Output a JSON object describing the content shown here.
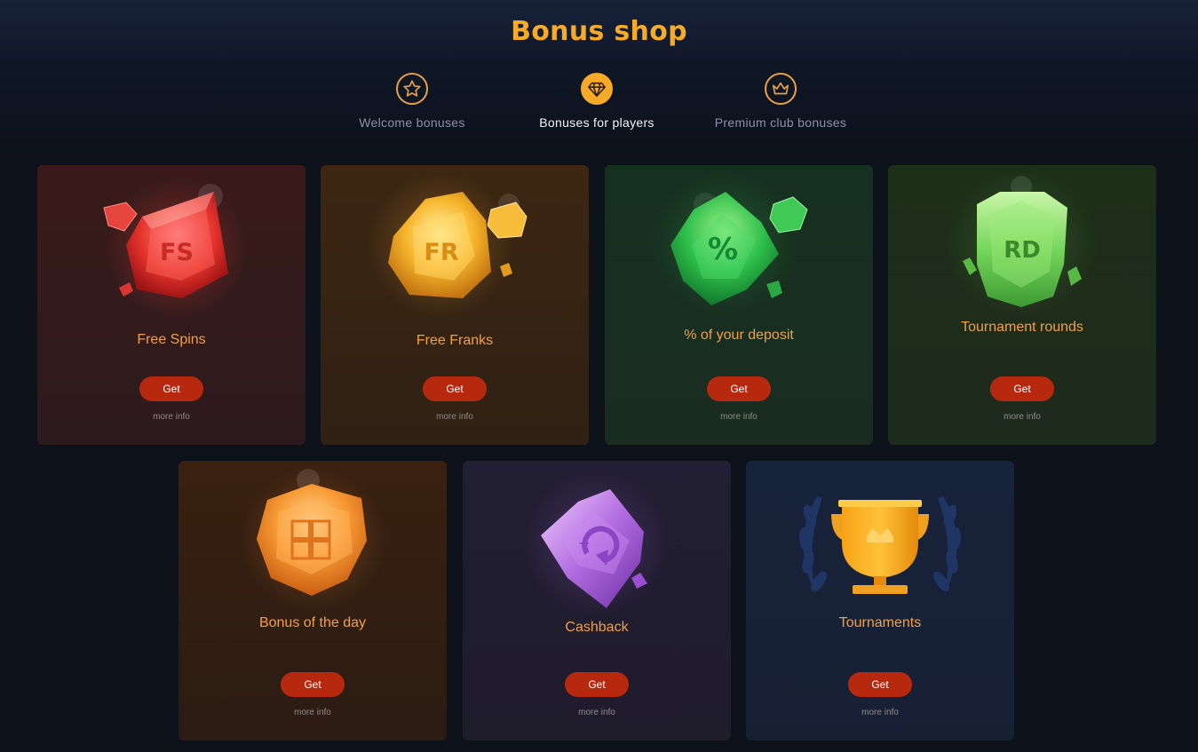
{
  "header": {
    "title": "Bonus shop"
  },
  "tabs": [
    {
      "label": "Welcome bonuses",
      "icon": "star-icon",
      "active": false
    },
    {
      "label": "Bonuses for players",
      "icon": "diamond-icon",
      "active": true
    },
    {
      "label": "Premium club bonuses",
      "icon": "crown-icon",
      "active": false
    }
  ],
  "cards": [
    {
      "title": "Free Spins",
      "badge": "FS",
      "button": "Get",
      "more": "more info",
      "icon": "red-gem-icon"
    },
    {
      "title": "Free Franks",
      "badge": "FR",
      "button": "Get",
      "more": "more info",
      "icon": "yellow-gem-icon"
    },
    {
      "title": "% of your deposit",
      "badge": "%",
      "button": "Get",
      "more": "more info",
      "icon": "green-gem-icon"
    },
    {
      "title": "Tournament rounds",
      "badge": "RD",
      "button": "Get",
      "more": "more info",
      "icon": "lime-gem-icon"
    },
    {
      "title": "Bonus of the day",
      "badge": "",
      "button": "Get",
      "more": "more info",
      "icon": "gift-gem-icon"
    },
    {
      "title": "Cashback",
      "badge": "",
      "button": "Get",
      "more": "more info",
      "icon": "purple-gem-icon"
    },
    {
      "title": "Tournaments",
      "badge": "",
      "button": "Get",
      "more": "more info",
      "icon": "trophy-icon"
    }
  ],
  "colors": {
    "accent": "#f7a928",
    "button": "#b7290f",
    "background": "#0c111a"
  }
}
